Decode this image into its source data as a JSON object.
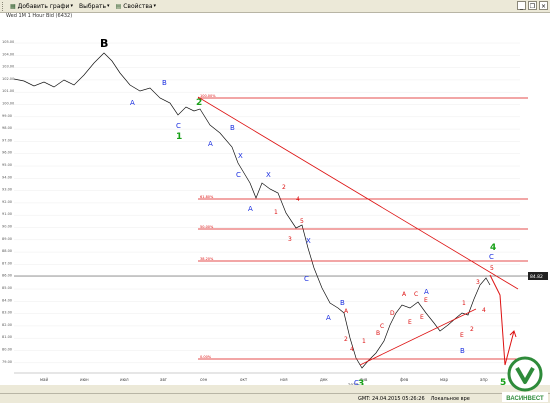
{
  "toolbar": {
    "add_chart": "Добавить графи",
    "select": "Выбрать",
    "properties": "Свойства"
  },
  "chart": {
    "title": "Wed 1M 1 Hour Bid (6432)",
    "price_label": "84.82",
    "y_ticks": [
      "105.00",
      "104.00",
      "103.00",
      "102.00",
      "101.00",
      "100.00",
      "99.00",
      "98.00",
      "97.00",
      "96.00",
      "95.00",
      "94.00",
      "93.00",
      "92.00",
      "91.00",
      "90.00",
      "89.00",
      "88.00",
      "87.00",
      "86.00",
      "85.00",
      "84.00",
      "83.00",
      "82.00",
      "81.00",
      "80.00",
      "79.00"
    ],
    "x_ticks": [
      "май",
      "июн",
      "июл",
      "авг",
      "сен",
      "окт",
      "ноя",
      "дек",
      "янв",
      "фев",
      "мар",
      "апр"
    ],
    "year_label": "2017",
    "fib_levels": [
      "100.00%",
      "61.80%",
      "50.00%",
      "38.20%",
      "0.00%"
    ],
    "colors": {
      "red": "#dd1111",
      "blue": "#1a2ee0",
      "green": "#18a018",
      "black": "#000000"
    }
  },
  "wave_labels": {
    "B_major": "B",
    "A1": "A",
    "B1": "B",
    "C1": "C",
    "w1": "1",
    "w2": "2",
    "A2": "A",
    "B2": "B",
    "X1": "X",
    "C2": "C",
    "X2": "X",
    "A3": "A",
    "n1": "1",
    "n2": "2",
    "n3": "3",
    "n4": "4",
    "n5": "5",
    "X3": "X",
    "C3": "C",
    "A4": "A",
    "B4": "B",
    "w3": "3",
    "r1": "1",
    "r2": "2",
    "r3": "3",
    "r4": "4",
    "r5": "5",
    "A5": "A",
    "r6": "A",
    "rB": "B",
    "rC": "C",
    "rD": "D",
    "rE": "E",
    "sA": "A",
    "sC": "C",
    "sE": "E",
    "bB": "B",
    "bA": "A",
    "bC": "C",
    "t1": "1",
    "t2": "2",
    "t3": "3",
    "t4": "4",
    "t5": "5",
    "w4": "4",
    "cC": "C",
    "c5": "5",
    "bE": "E",
    "b5": "5"
  },
  "status": {
    "gmt": "GMT: 24.04.2015 05:26:26",
    "local": "Локальное вре"
  },
  "logo": {
    "text": "ВАСИНВЕСТ"
  }
}
